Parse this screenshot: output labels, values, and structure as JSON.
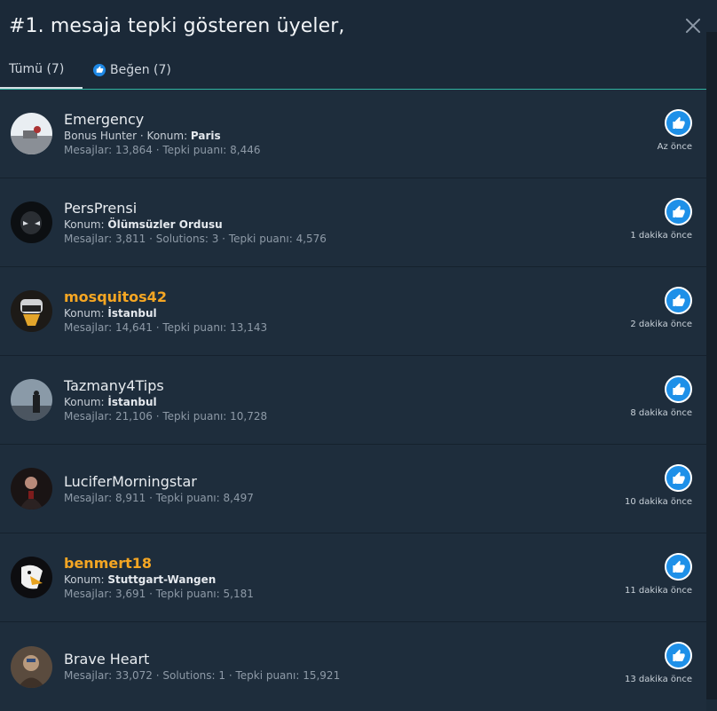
{
  "header": {
    "title": "#1. mesaja tepki gösteren üyeler,"
  },
  "tabs": [
    {
      "label": "Tümü (7)"
    },
    {
      "label": "Beğen (7)"
    }
  ],
  "colors": {
    "accent": "#2fb3a0",
    "like": "#1e90e8",
    "gold_username": "#f5a623"
  },
  "reactions": [
    {
      "name": "Emergency",
      "sub_plain": "Bonus Hunter · Konum: ",
      "sub_bold": "Paris",
      "stats": "Mesajlar: 13,864 · Tepki puanı: 8,446",
      "time": "Az önce"
    },
    {
      "name": "PersPrensi",
      "sub_plain": "Konum: ",
      "sub_bold": "Ölümsüzler Ordusu",
      "stats": "Mesajlar: 3,811 · Solutions: 3 · Tepki puanı: 4,576",
      "time": "1 dakika önce"
    },
    {
      "name": "mosquitos42",
      "sub_plain": "Konum: ",
      "sub_bold": "İstanbul",
      "stats": "Mesajlar: 14,641 · Tepki puanı: 13,143",
      "time": "2 dakika önce"
    },
    {
      "name": "Tazmany4Tips",
      "sub_plain": "Konum: ",
      "sub_bold": "İstanbul",
      "stats": "Mesajlar: 21,106 · Tepki puanı: 10,728",
      "time": "8 dakika önce"
    },
    {
      "name": "LuciferMorningstar",
      "stats": "Mesajlar: 8,911 · Tepki puanı: 8,497",
      "time": "10 dakika önce"
    },
    {
      "name": "benmert18",
      "sub_plain": "Konum: ",
      "sub_bold": "Stuttgart-Wangen",
      "stats": "Mesajlar: 3,691 · Tepki puanı: 5,181",
      "time": "11 dakika önce"
    },
    {
      "name": "Brave Heart",
      "stats": "Mesajlar: 33,072 · Solutions: 1 · Tepki puanı: 15,921",
      "time": "13 dakika önce"
    }
  ]
}
